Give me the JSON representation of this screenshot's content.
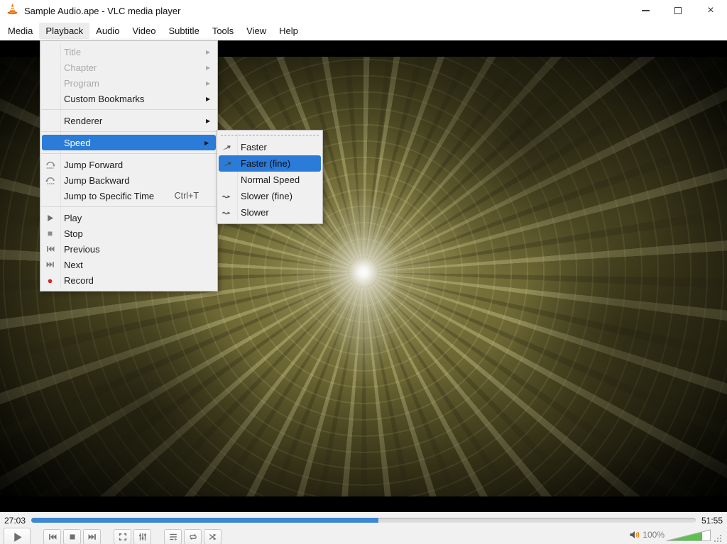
{
  "window": {
    "title": "Sample Audio.ape - VLC media player",
    "controls": [
      "minimize",
      "maximize",
      "close"
    ],
    "close_glyph": "×"
  },
  "menu_bar": {
    "items": [
      {
        "label": "Media"
      },
      {
        "label": "Playback",
        "active": true
      },
      {
        "label": "Audio"
      },
      {
        "label": "Video"
      },
      {
        "label": "Subtitle"
      },
      {
        "label": "Tools"
      },
      {
        "label": "View"
      },
      {
        "label": "Help"
      }
    ]
  },
  "playback_menu": {
    "items": [
      {
        "label": "Title",
        "disabled": true,
        "submenu": true
      },
      {
        "label": "Chapter",
        "disabled": true,
        "submenu": true
      },
      {
        "label": "Program",
        "disabled": true,
        "submenu": true
      },
      {
        "label": "Custom Bookmarks",
        "submenu": true
      },
      {
        "label": "Renderer",
        "submenu": true
      },
      {
        "label": "Speed",
        "submenu": true,
        "highlighted": true
      },
      {
        "label": "Jump Forward",
        "icon": "jump-forward-icon"
      },
      {
        "label": "Jump Backward",
        "icon": "jump-backward-icon"
      },
      {
        "label": "Jump to Specific Time",
        "shortcut": "Ctrl+T"
      },
      {
        "label": "Play",
        "icon": "play-icon"
      },
      {
        "label": "Stop",
        "icon": "stop-icon"
      },
      {
        "label": "Previous",
        "icon": "previous-icon"
      },
      {
        "label": "Next",
        "icon": "next-icon"
      },
      {
        "label": "Record",
        "icon": "record-icon"
      }
    ]
  },
  "speed_submenu": {
    "items": [
      {
        "label": "Faster",
        "icon": "faster-icon"
      },
      {
        "label": "Faster (fine)",
        "icon": "faster-icon",
        "highlighted": true
      },
      {
        "label": "Normal Speed"
      },
      {
        "label": "Slower (fine)",
        "icon": "slower-icon"
      },
      {
        "label": "Slower",
        "icon": "slower-icon"
      }
    ]
  },
  "seek": {
    "elapsed": "27:03",
    "duration": "51:55",
    "progress_pct": 52.2
  },
  "transport": {
    "buttons": [
      "play",
      "previous",
      "stop",
      "next",
      "fullscreen",
      "extended-settings",
      "playlist",
      "loop",
      "random"
    ]
  },
  "volume": {
    "label": "100%",
    "fill_pct": 80
  },
  "icons": {
    "submenu_arrow": "▶",
    "stop_glyph": "■",
    "record_glyph": "●"
  },
  "colors": {
    "menu_highlight": "#2a7cd8",
    "seek_fill": "#3c87d2",
    "record_red": "#dd2222",
    "volume_green": "#5bc24c",
    "cone_orange": "#e87a19",
    "speaker_wave_orange": "#e8830c"
  }
}
